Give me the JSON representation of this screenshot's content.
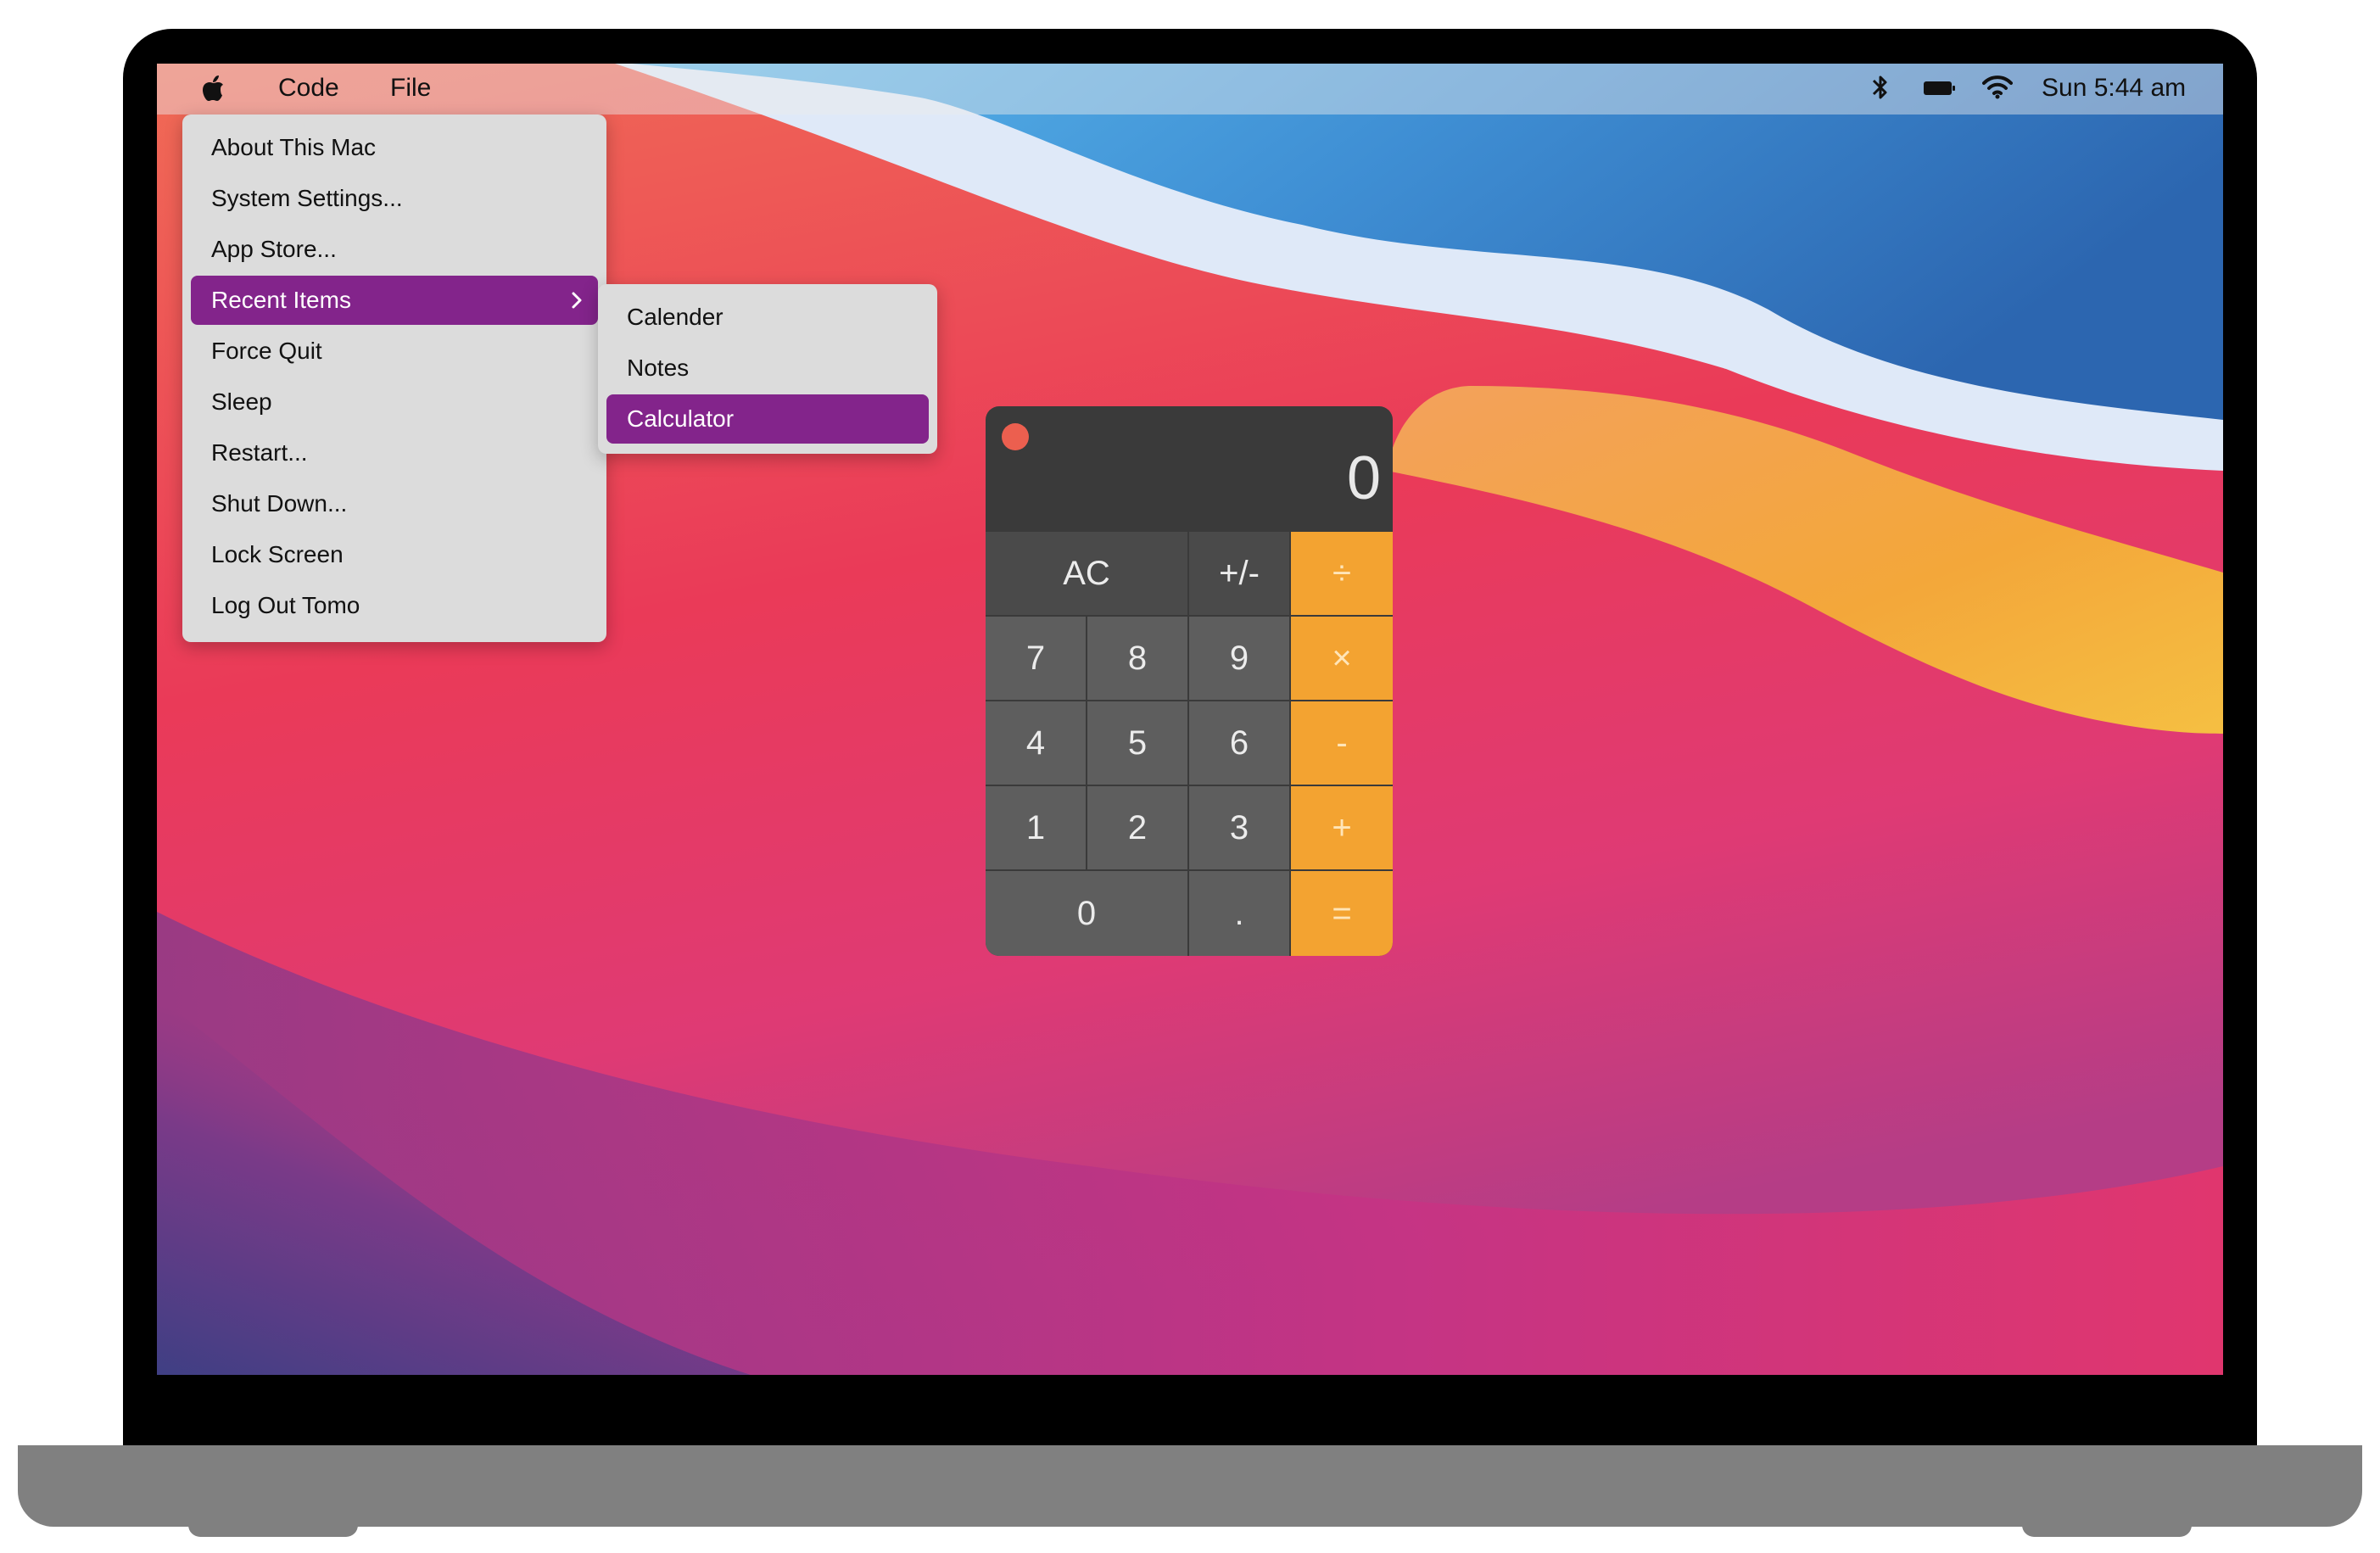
{
  "menubar": {
    "apple_icon": "apple-icon",
    "app_name": "Code",
    "menus": [
      "File"
    ],
    "status_icons": [
      "bluetooth-icon",
      "battery-icon",
      "wifi-icon"
    ],
    "clock": "Sun 5:44 am"
  },
  "apple_menu": {
    "items": [
      {
        "label": "About This Mac"
      },
      {
        "label": "System Settings..."
      },
      {
        "label": "App Store..."
      },
      {
        "label": "Recent Items",
        "has_submenu": true,
        "highlighted": true
      },
      {
        "label": "Force Quit"
      },
      {
        "label": "Sleep"
      },
      {
        "label": "Restart..."
      },
      {
        "label": "Shut Down..."
      },
      {
        "label": "Lock Screen"
      },
      {
        "label": "Log Out Tomo"
      }
    ]
  },
  "recent_items_submenu": {
    "items": [
      {
        "label": "Calender"
      },
      {
        "label": "Notes"
      },
      {
        "label": "Calculator",
        "highlighted": true
      }
    ]
  },
  "calculator": {
    "display": "0",
    "keys": {
      "ac": "AC",
      "sign": "+/-",
      "divide": "÷",
      "k7": "7",
      "k8": "8",
      "k9": "9",
      "multiply": "×",
      "k4": "4",
      "k5": "5",
      "k6": "6",
      "minus": "-",
      "k1": "1",
      "k2": "2",
      "k3": "3",
      "plus": "+",
      "k0": "0",
      "decimal": ".",
      "equals": "="
    }
  },
  "colors": {
    "highlight": "#83248b",
    "operator": "#f3a331",
    "close_button": "#ec5f4f"
  }
}
